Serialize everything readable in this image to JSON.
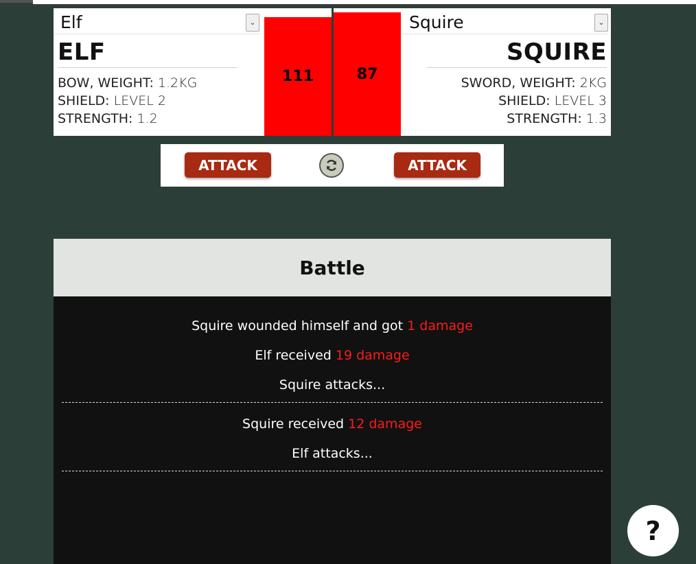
{
  "left_fighter": {
    "select_value": "Elf",
    "name": "ELF",
    "weapon_label": "BOW, WEIGHT:",
    "weapon_value": "1.2KG",
    "shield_label": "SHIELD:",
    "shield_value": "LEVEL 2",
    "strength_label": "STRENGTH:",
    "strength_value": "1.2",
    "health": "111",
    "health_fraction": 0.93
  },
  "right_fighter": {
    "select_value": "Squire",
    "name": "SQUIRE",
    "weapon_label": "SWORD, WEIGHT:",
    "weapon_value": "2KG",
    "shield_label": "SHIELD:",
    "shield_value": "LEVEL 3",
    "strength_label": "STRENGTH:",
    "strength_value": "1.3",
    "health": "87",
    "health_fraction": 0.97
  },
  "controls": {
    "attack_left_label": "ATTACK",
    "attack_right_label": "ATTACK",
    "reset_icon": "refresh-icon"
  },
  "battle": {
    "title": "Battle",
    "log": [
      {
        "text": "Squire wounded himself and got ",
        "dmg": "1 damage"
      },
      {
        "text": "Elf received ",
        "dmg": "19 damage"
      },
      {
        "text": "Squire attacks...",
        "dmg": ""
      },
      {
        "text": "Squire received ",
        "dmg": "12 damage"
      },
      {
        "text": "Elf attacks...",
        "dmg": ""
      }
    ]
  },
  "help": {
    "label": "?"
  },
  "colors": {
    "background": "#2c3e38",
    "health_bar": "#ff0000",
    "attack_button": "#a82a12",
    "damage_text": "#ff1a1a"
  }
}
